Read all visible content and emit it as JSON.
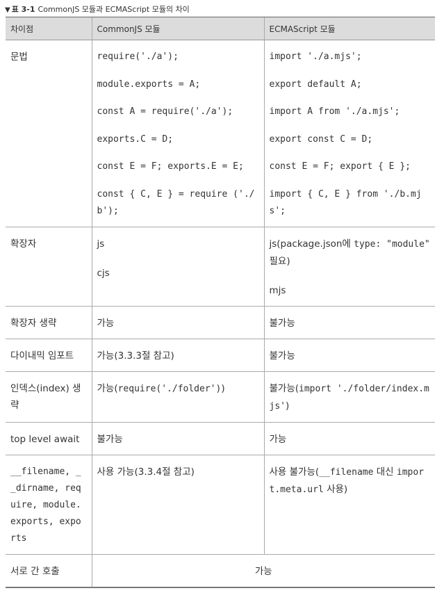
{
  "caption": {
    "marker": "▼",
    "number": "표 3-1",
    "title": "CommonJS 모듈과 ECMAScript 모듈의 차이"
  },
  "headers": [
    "차이점",
    "CommonJS 모듈",
    "ECMAScript 모듈"
  ],
  "rows": {
    "syntax": {
      "label": "문법",
      "cjs": [
        "require('./a');",
        "module.exports = A;",
        "const A = require('./a');",
        "exports.C = D;",
        "const E = F; exports.E = E;",
        "const { C, E } = require ('./b');"
      ],
      "esm": [
        "import './a.mjs';",
        "export default A;",
        "import A from './a.mjs';",
        "export const C = D;",
        "const E = F; export { E };",
        "import { C, E } from './b.mjs';"
      ]
    },
    "extension": {
      "label": "확장자",
      "cjs": [
        "js",
        "cjs"
      ],
      "esm_a_pre": "js(package.json에 ",
      "esm_a_code": "type: \"module\"",
      "esm_a_post": " 필요)",
      "esm_b": "mjs"
    },
    "ext_omit": {
      "label": "확장자 생략",
      "cjs": "가능",
      "esm": "불가능"
    },
    "dynamic_import": {
      "label": "다이내믹 임포트",
      "cjs": "가능(3.3.3절 참고)",
      "esm": "불가능"
    },
    "index": {
      "label": "인덱스(index) 생략",
      "cjs_pre": "가능(",
      "cjs_code": "require('./folder')",
      "cjs_post": ")",
      "esm_pre": "불가능(",
      "esm_code": "import './folder/index.mjs'",
      "esm_post": ")"
    },
    "tla": {
      "label": "top level await",
      "cjs": "불가능",
      "esm": "가능"
    },
    "globals": {
      "label": "__filename, __dirname, require, module.exports, exports",
      "cjs": "사용 가능(3.3.4절 참고)",
      "esm_pre": "사용 불가능(",
      "esm_code1": "__filename",
      "esm_mid": " 대신 ",
      "esm_code2": "import.meta.url",
      "esm_post": " 사용)"
    },
    "interop": {
      "label": "서로 간 호출",
      "value": "가능"
    }
  }
}
